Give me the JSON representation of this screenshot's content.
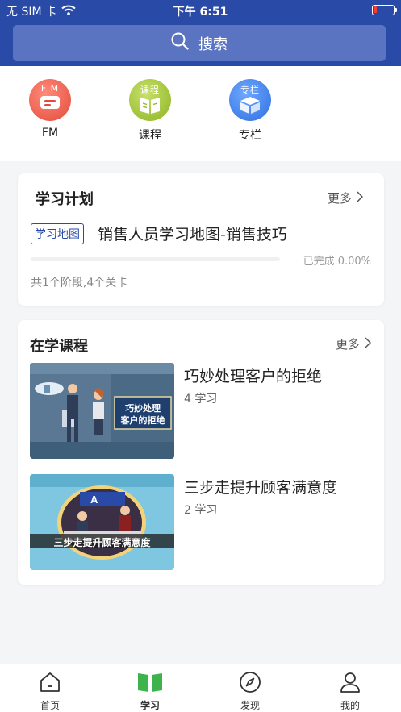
{
  "status": {
    "carrier": "无 SIM 卡",
    "time": "下午 6:51"
  },
  "search": {
    "label": "搜索"
  },
  "quick": [
    {
      "icon": "fm-icon",
      "tag": "F M",
      "label": "FM"
    },
    {
      "icon": "course-icon",
      "tag": "课程",
      "label": "课程"
    },
    {
      "icon": "column-icon",
      "tag": "专栏",
      "label": "专栏"
    }
  ],
  "plan": {
    "title": "学习计划",
    "more": "更多",
    "tag": "学习地图",
    "name": "销售人员学习地图-销售技巧",
    "progress_fraction": 0.0,
    "progress_text": "已完成 0.00%",
    "stats": "共1个阶段,4个关卡"
  },
  "learning": {
    "title": "在学课程",
    "more": "更多",
    "courses": [
      {
        "title": "巧妙处理客户的拒绝",
        "count": "4 学习",
        "thumb_text_1": "巧妙处理",
        "thumb_text_2": "客户的拒绝"
      },
      {
        "title": "三步走提升顾客满意度",
        "count": "2 学习",
        "thumb_text": "三步走提升顾客满意度"
      }
    ]
  },
  "tabs": [
    {
      "label": "首页",
      "icon": "home-icon",
      "active": false
    },
    {
      "label": "学习",
      "icon": "book-icon",
      "active": true
    },
    {
      "label": "发现",
      "icon": "compass-icon",
      "active": false
    },
    {
      "label": "我的",
      "icon": "user-icon",
      "active": false
    }
  ],
  "colors": {
    "brand": "#2a4aa8",
    "active_tab": "#3cb44b"
  }
}
